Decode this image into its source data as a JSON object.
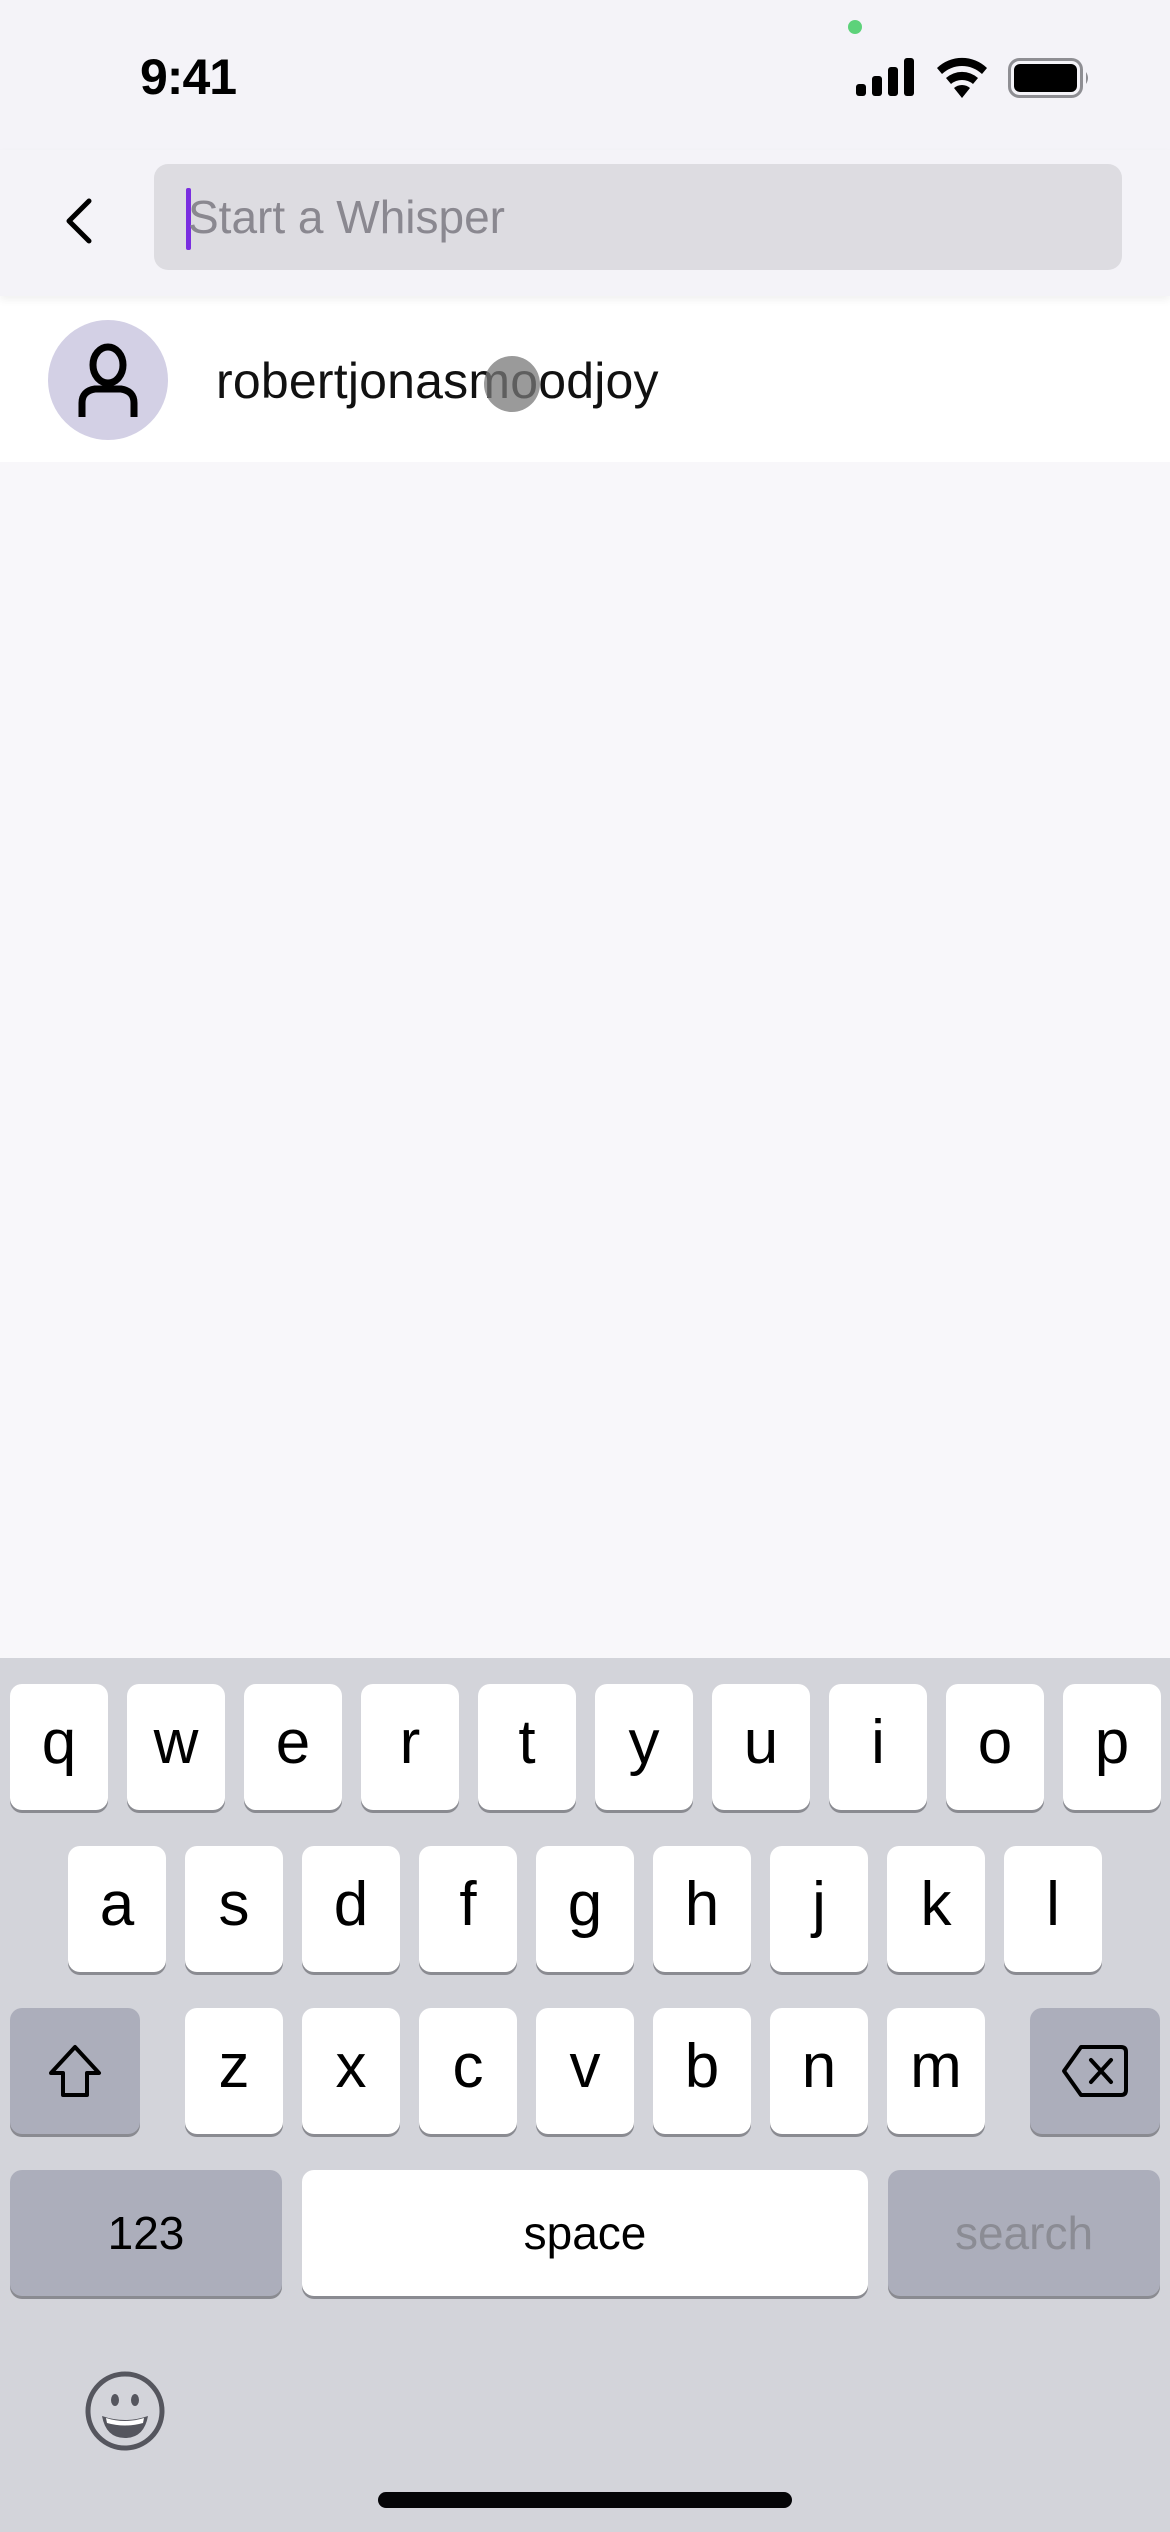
{
  "status_bar": {
    "time": "9:41",
    "icons": [
      "camera-in-use-dot",
      "cellular-signal-icon",
      "wifi-icon",
      "battery-icon"
    ]
  },
  "header": {
    "back_icon": "chevron-left-icon",
    "search": {
      "value": "",
      "placeholder": "Start a Whisper"
    }
  },
  "results": [
    {
      "avatar_icon": "person-icon",
      "username": "robertjonasmoodjoy"
    }
  ],
  "keyboard": {
    "row1": [
      "q",
      "w",
      "e",
      "r",
      "t",
      "y",
      "u",
      "i",
      "o",
      "p"
    ],
    "row2": [
      "a",
      "s",
      "d",
      "f",
      "g",
      "h",
      "j",
      "k",
      "l"
    ],
    "row3": [
      "z",
      "x",
      "c",
      "v",
      "b",
      "n",
      "m"
    ],
    "shift_icon": "shift-icon",
    "delete_icon": "delete-backspace-icon",
    "numbers_label": "123",
    "space_label": "space",
    "return_label": "search",
    "emoji_icon": "emoji-icon"
  },
  "colors": {
    "caret": "#7a2ee0",
    "avatar_bg": "#d3d0e5",
    "camera_dot": "#5dd27a"
  }
}
